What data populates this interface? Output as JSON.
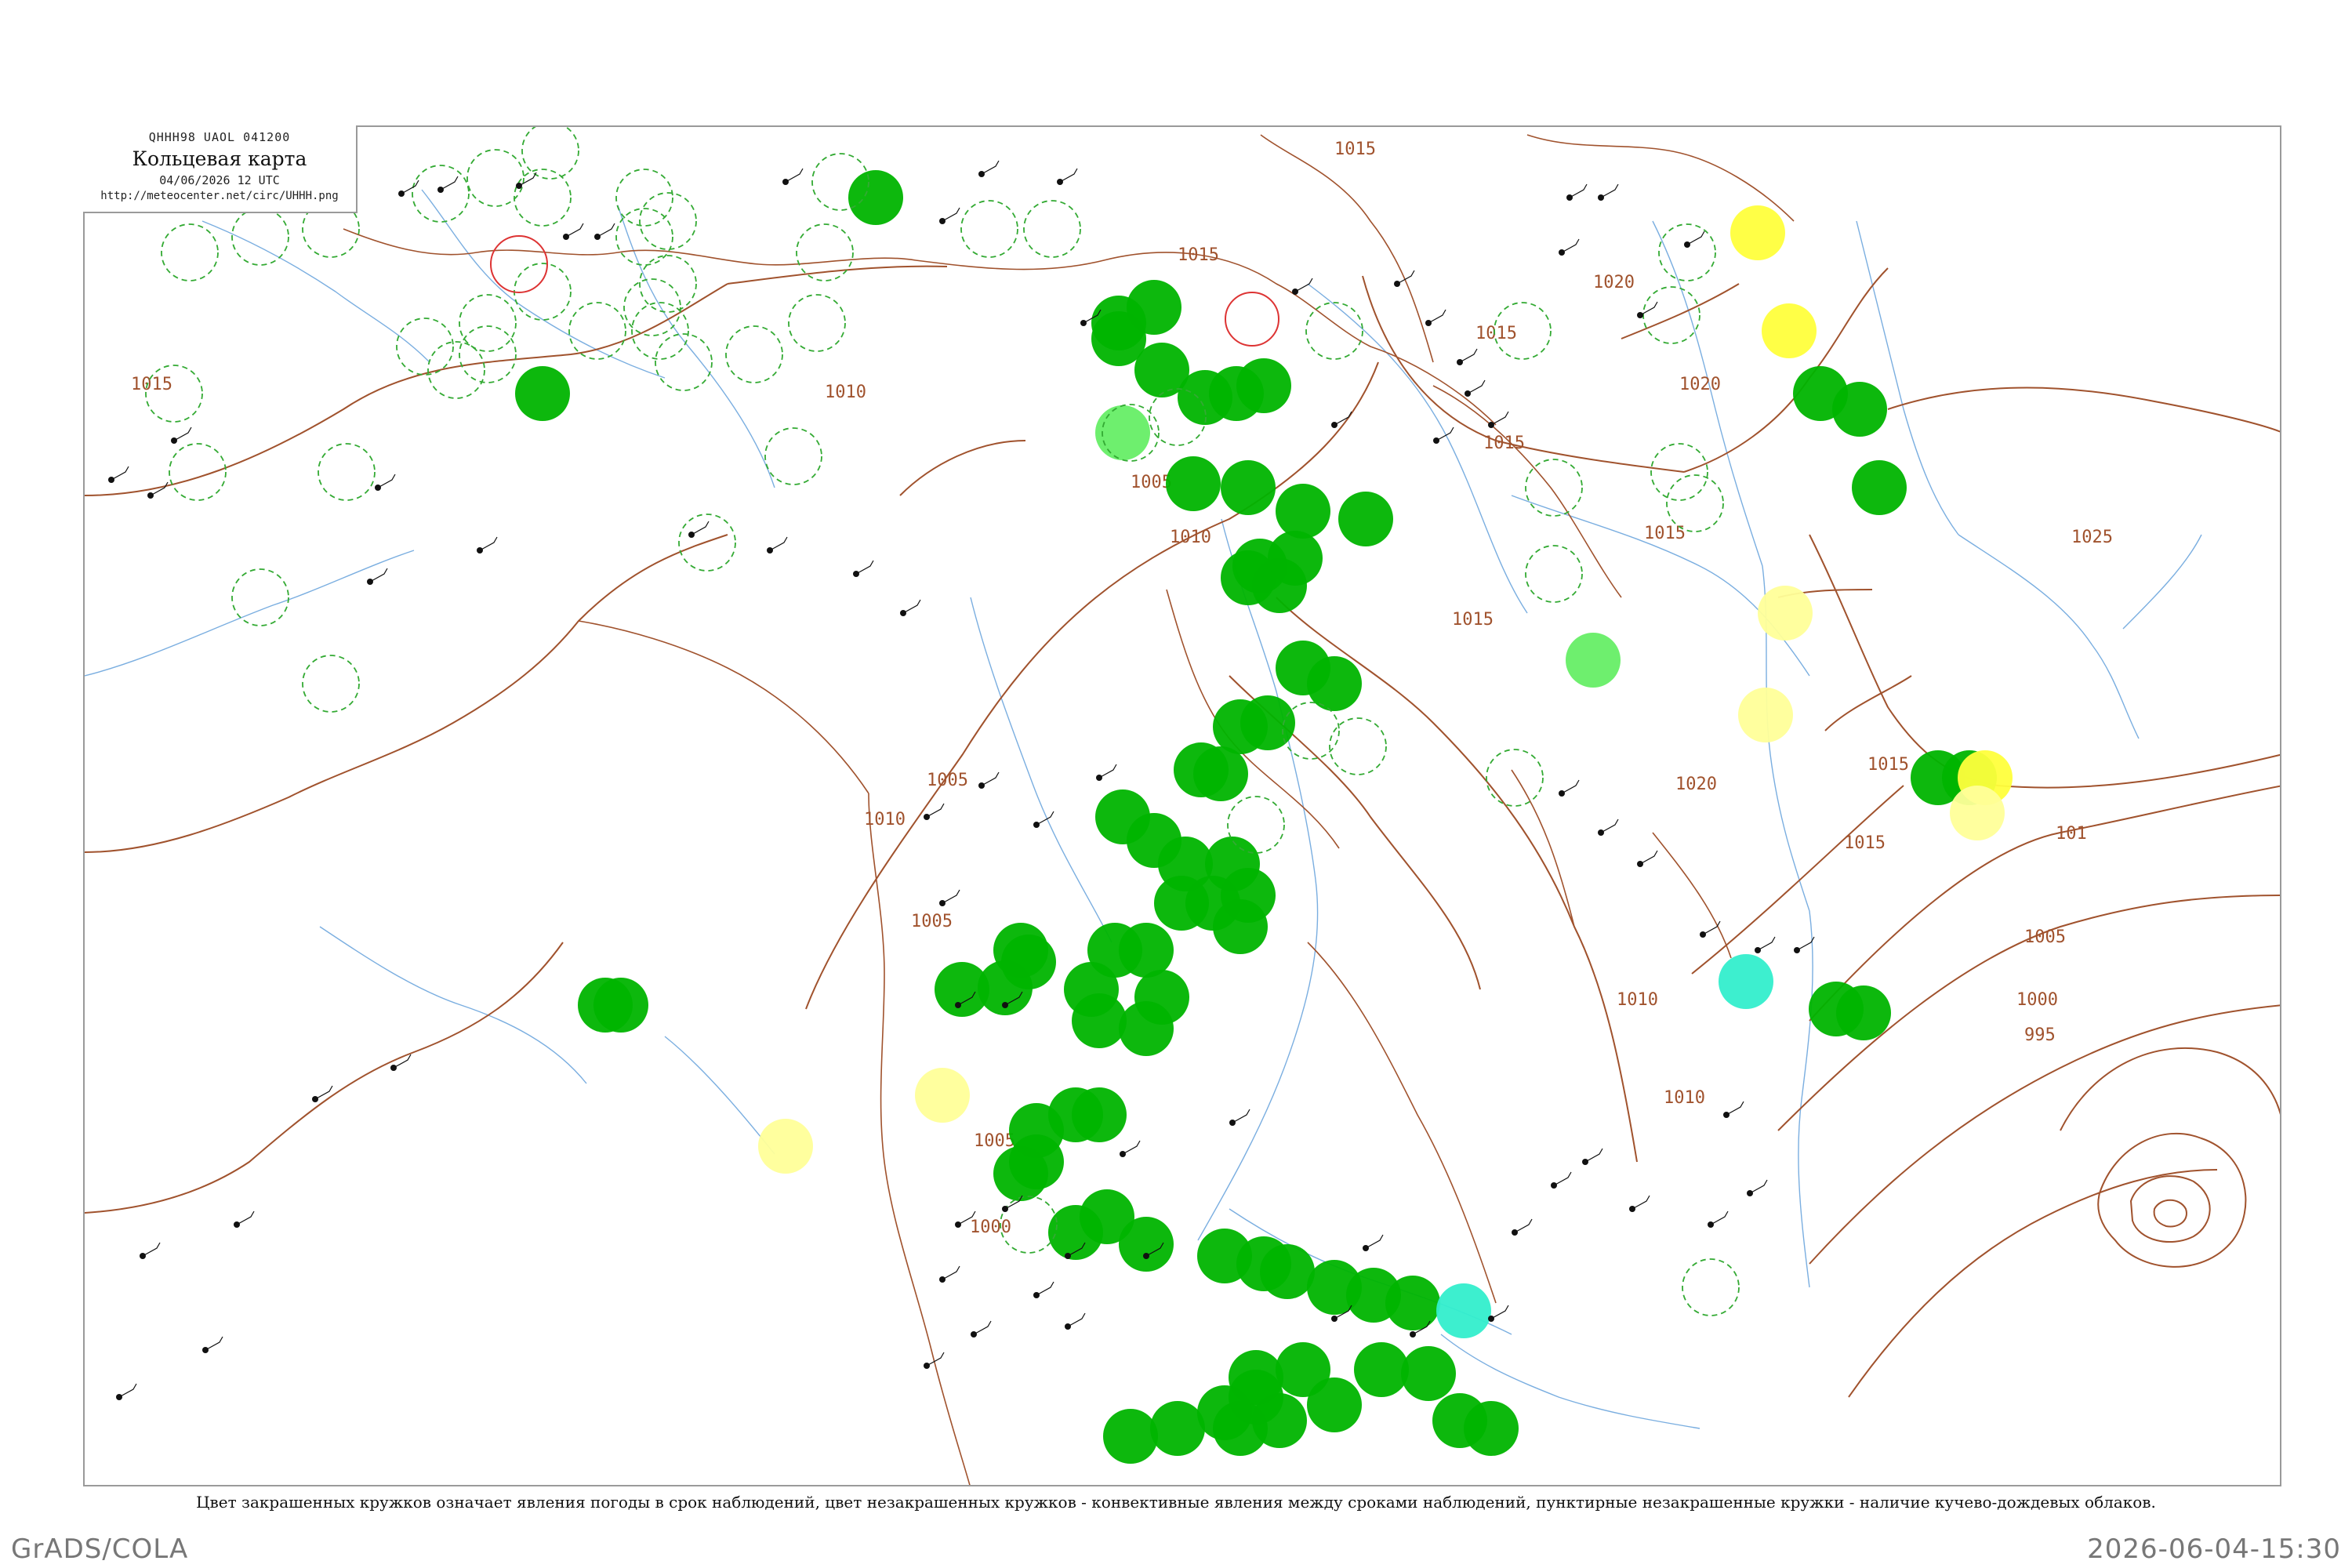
{
  "title": {
    "code": "QHHH98  UAOL  041200",
    "main": "Кольцевая карта",
    "date": "04/06/2026 12 UTC",
    "url": "http://meteocenter.net/circ/UHHH.png"
  },
  "caption": "Цвет закрашенных кружков означает явления погоды в срок наблюдений, цвет незакрашенных кружков - конвективные явления между сроками наблюдений, пунктирные незакрашенные кружки - наличие кучево-дождевых облаков.",
  "footer": {
    "left": "GrADS/COLA",
    "right": "2026-06-04-15:30"
  },
  "colors": {
    "isobar": "#a0522d",
    "border": "#a0522d",
    "river": "#7aaee0",
    "precip_green": "#00b400",
    "light_green": "#66ee66",
    "yellow": "#ffff3c",
    "pale_yellow": "#ffff99",
    "cyan": "#33eecc",
    "dashed_green": "#33aa33",
    "red_ring": "#dd3333"
  },
  "isobar_labels": [
    {
      "text": "1015",
      "type": "isobar"
    },
    {
      "text": "1010",
      "type": "isobar"
    },
    {
      "text": "1005",
      "type": "isobar"
    },
    {
      "text": "1015",
      "type": "isobar"
    },
    {
      "text": "1010",
      "type": "isobar"
    },
    {
      "text": "1005",
      "type": "isobar"
    },
    {
      "text": "1005",
      "type": "isobar"
    },
    {
      "text": "1000",
      "type": "isobar"
    },
    {
      "text": "1015",
      "type": "isobar"
    },
    {
      "text": "1020",
      "type": "isobar"
    },
    {
      "text": "1015",
      "type": "isobar"
    },
    {
      "text": "1015",
      "type": "isobar"
    },
    {
      "text": "1020",
      "type": "isobar"
    },
    {
      "text": "1025",
      "type": "isobar"
    },
    {
      "text": "1015",
      "type": "isobar"
    },
    {
      "text": "1010",
      "type": "isobar"
    },
    {
      "text": "1005",
      "type": "isobar"
    },
    {
      "text": "1000",
      "type": "isobar"
    },
    {
      "text": "995",
      "type": "isobar"
    },
    {
      "text": "1020",
      "type": "isobar"
    },
    {
      "text": "1010",
      "type": "isobar"
    },
    {
      "text": "1015",
      "type": "isobar"
    },
    {
      "text": "1005",
      "type": "isobar"
    },
    {
      "text": "1015",
      "type": "isobar"
    },
    {
      "text": "1015",
      "type": "isobar"
    },
    {
      "text": "1010",
      "type": "isobar"
    },
    {
      "text": "101",
      "type": "isobar"
    }
  ],
  "station_markers": [
    {
      "kind": "filled",
      "color": "green"
    },
    {
      "kind": "filled",
      "color": "yellow"
    },
    {
      "kind": "filled",
      "color": "pale_yellow"
    },
    {
      "kind": "filled",
      "color": "cyan"
    },
    {
      "kind": "filled",
      "color": "light_green"
    },
    {
      "kind": "dashed",
      "color": "dashed_green"
    },
    {
      "kind": "ring",
      "color": "red_ring"
    }
  ]
}
